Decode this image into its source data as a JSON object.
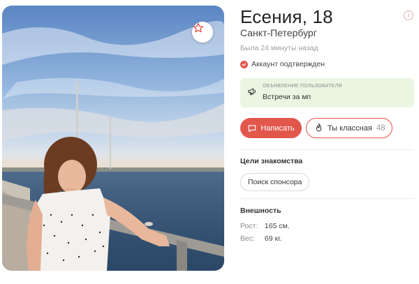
{
  "profile": {
    "name_age": "Есения, 18",
    "city": "Санкт-Петербург",
    "last_seen": "Была 24 минуты назад",
    "verified_text": "Аккаунт подтвержден"
  },
  "announcement": {
    "label": "ОБЪЯВЛЕНИЕ ПОЛЬЗОВАТЕЛЯ",
    "text": "Встречи за мп"
  },
  "actions": {
    "write_label": "Написать",
    "like_label": "Ты классная",
    "like_count": "48"
  },
  "goals": {
    "title": "Цели знакомства",
    "items": [
      "Поиск спонсора"
    ]
  },
  "appearance": {
    "title": "Внешность",
    "height_label": "Рост:",
    "height_value": "165 см.",
    "weight_label": "Вес:",
    "weight_value": "69 кг."
  },
  "icons": {
    "favorite": "star-icon",
    "info": "info-icon",
    "verified": "check-circle-icon",
    "announcement": "megaphone-icon",
    "write": "chat-bubble-icon",
    "like": "flame-icon"
  },
  "colors": {
    "accent": "#e2574c",
    "announcement_bg": "#eaf6e2",
    "muted_text": "#9c9c9c"
  }
}
